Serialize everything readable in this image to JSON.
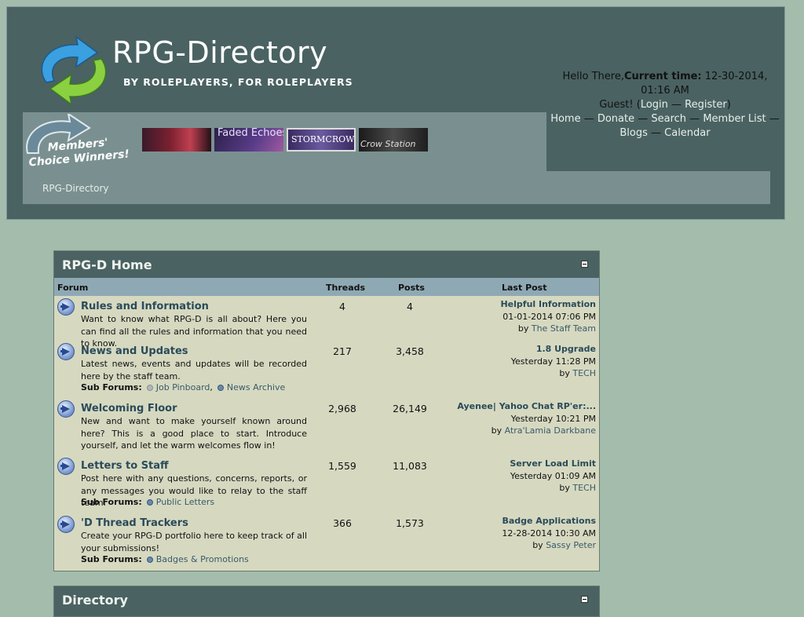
{
  "header": {
    "logo_title": "RPG-Directory",
    "logo_tagline": "BY ROLEPLAYERS, FOR ROLEPLAYERS",
    "greeting": "Hello There,",
    "current_time_label": "Current time:",
    "current_time": "12-30-2014, 01:16 AM",
    "guest": "Guest! (",
    "login": "Login",
    "sep1": " — ",
    "register": "Register",
    "close_paren": ")",
    "nav": [
      {
        "label": "Home"
      },
      {
        "label": "Donate"
      },
      {
        "label": "Search"
      },
      {
        "label": "Member List"
      },
      {
        "label": "Blogs"
      },
      {
        "label": "Calendar"
      }
    ],
    "nav_sep": " — ",
    "members_choice": "Members' Choice Winners!",
    "affiliates": [
      "",
      "Faded Echoes",
      "STORMCROWN",
      "Crow Station"
    ],
    "breadcrumb": "RPG-Directory"
  },
  "forum_section": {
    "title": "RPG-D Home",
    "columns": {
      "forum": "Forum",
      "threads": "Threads",
      "posts": "Posts",
      "last_post": "Last Post"
    },
    "sub_forums_label": "Sub Forums:",
    "rows": [
      {
        "title": "Rules and Information",
        "description": "Want to know what RPG-D is all about? Here you can find all the rules and information that you need to know.",
        "threads": "4",
        "posts": "4",
        "last_post": {
          "title": "Helpful Information",
          "date": "01-01-2014 07:06 PM",
          "by": "by",
          "user": "The Staff Team"
        },
        "sub_forums": []
      },
      {
        "title": "News and Updates",
        "description": "Latest news, events and updates will be recorded here by the staff team.",
        "threads": "217",
        "posts": "3,458",
        "last_post": {
          "title": "1.8 Upgrade",
          "date": "Yesterday 11:28 PM",
          "by": "by",
          "user": "TECH"
        },
        "sub_forums": [
          "Job Pinboard",
          "News Archive"
        ]
      },
      {
        "title": "Welcoming Floor",
        "description": "New and want to make yourself known around here? This is a good place to start. Introduce yourself, and let the warm welcomes flow in!",
        "threads": "2,968",
        "posts": "26,149",
        "last_post": {
          "title": "Ayenee| Yahoo Chat RP'er:...",
          "date": "Yesterday 10:21 PM",
          "by": "by",
          "user": "Atra'Lamia Darkbane"
        },
        "sub_forums": []
      },
      {
        "title": "Letters to Staff",
        "description": "Post here with any questions, concerns, reports, or any messages you would like to relay to the staff team.",
        "threads": "1,559",
        "posts": "11,083",
        "last_post": {
          "title": "Server Load Limit",
          "date": "Yesterday 01:09 AM",
          "by": "by",
          "user": "TECH"
        },
        "sub_forums": [
          "Public Letters"
        ]
      },
      {
        "title": "'D Thread Trackers",
        "description": "Create your RPG-D portfolio here to keep track of all your submissions!",
        "threads": "366",
        "posts": "1,573",
        "last_post": {
          "title": "Badge Applications",
          "date": "12-28-2014 10:30 AM",
          "by": "by",
          "user": "Sassy Peter"
        },
        "sub_forums": [
          "Badges & Promotions"
        ]
      }
    ]
  },
  "directory_section": {
    "title": "Directory"
  }
}
